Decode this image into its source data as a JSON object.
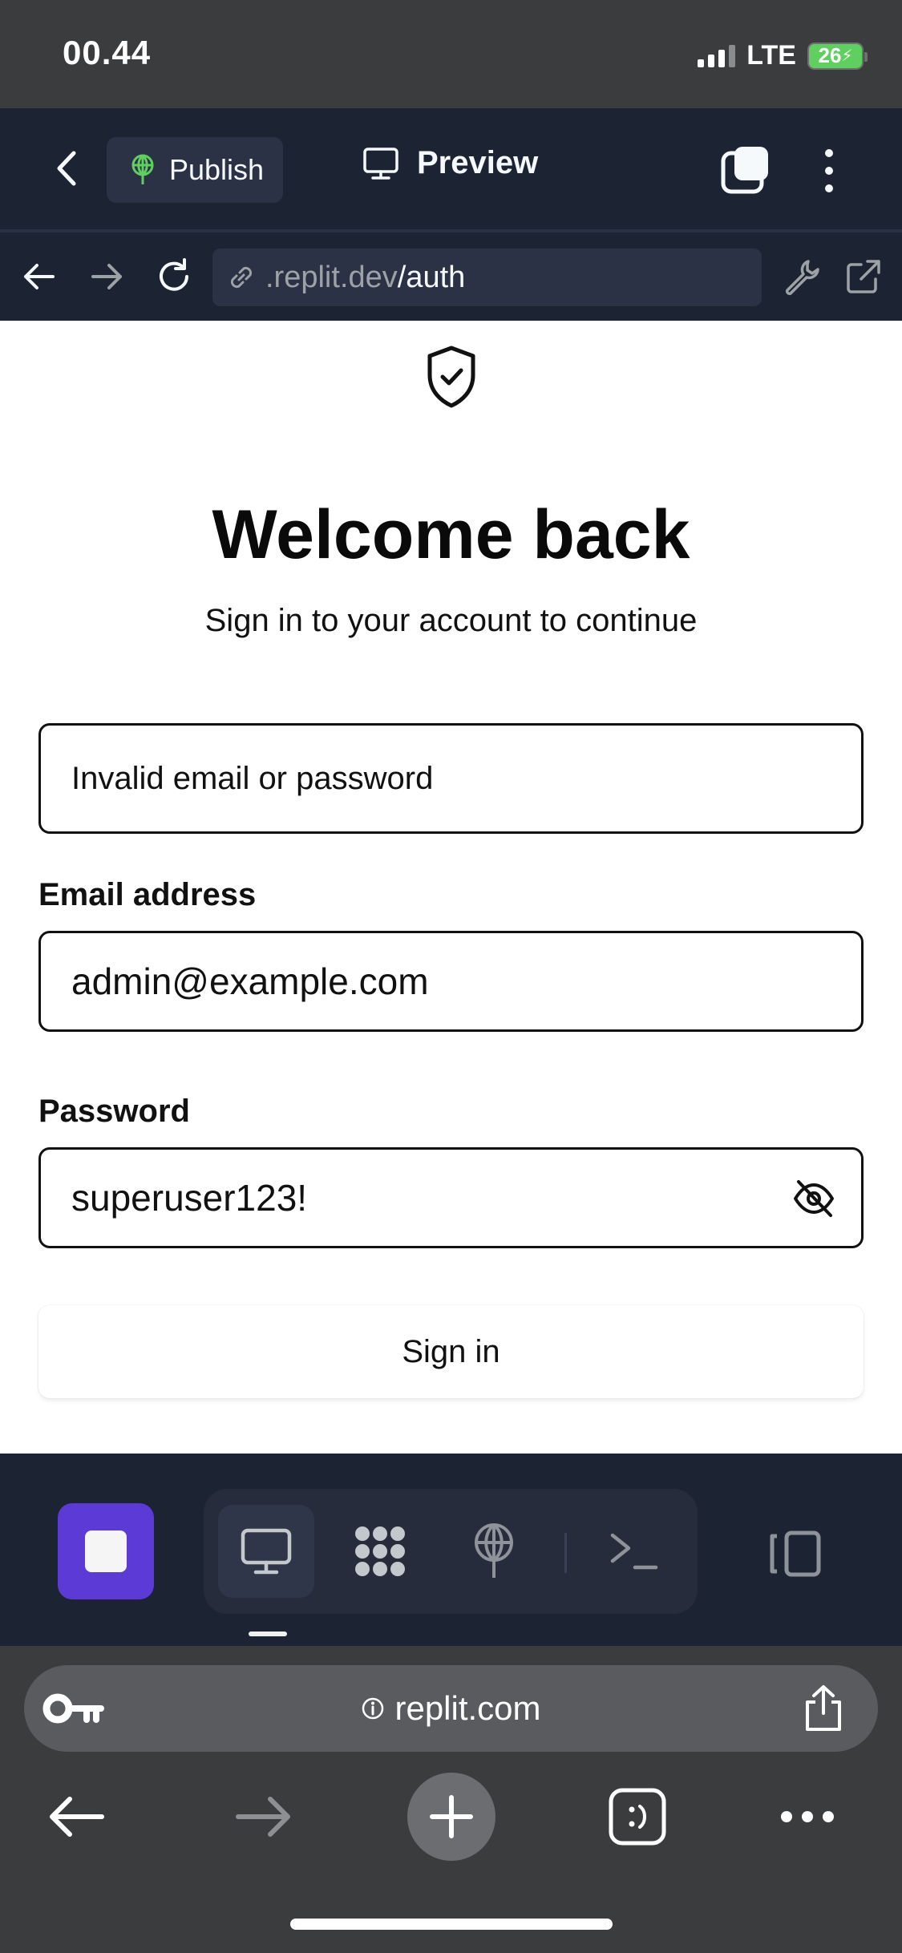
{
  "status_bar": {
    "time": "00.44",
    "network": "LTE",
    "battery": "26"
  },
  "top_toolbar": {
    "publish_label": "Publish",
    "preview_label": "Preview"
  },
  "address_bar": {
    "url_host": ".replit.dev",
    "url_path": "/auth"
  },
  "auth": {
    "title": "Welcome back",
    "subtitle": "Sign in to your account to continue",
    "error_message": "Invalid email or password",
    "email_label": "Email address",
    "email_value": "admin@example.com",
    "password_label": "Password",
    "password_value": "superuser123!",
    "signin_label": "Sign in"
  },
  "safari": {
    "url": "replit.com"
  },
  "colors": {
    "replit_dark": "#1c2333",
    "stop_purple": "#5b3ad6",
    "publish_green": "#5fcf5f"
  }
}
